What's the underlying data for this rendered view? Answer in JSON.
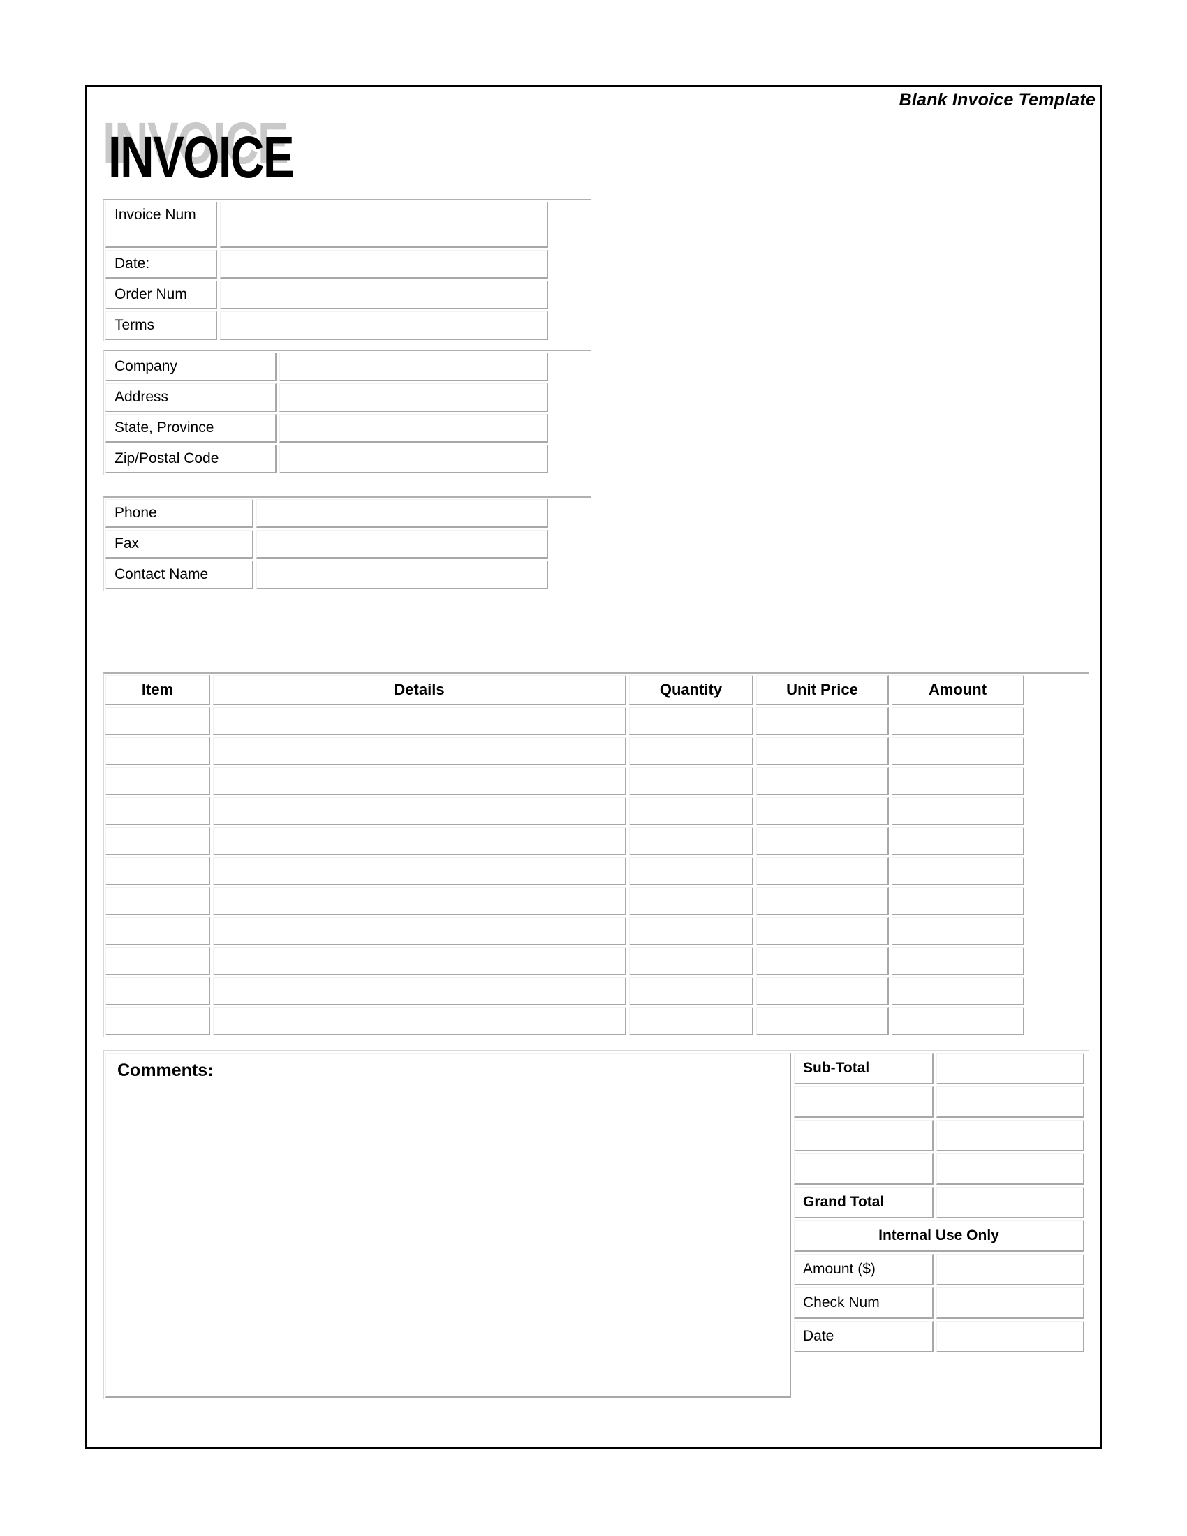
{
  "document": {
    "header_title": "Blank Invoice Template",
    "logo_text": "INVOICE"
  },
  "invoice_info": {
    "rows": [
      {
        "label": "Invoice Num",
        "value": ""
      },
      {
        "label": "Date:",
        "value": ""
      },
      {
        "label": "Order Num",
        "value": ""
      },
      {
        "label": "Terms",
        "value": ""
      }
    ]
  },
  "bill_to": {
    "rows": [
      {
        "label": "Company",
        "value": ""
      },
      {
        "label": "Address",
        "value": ""
      },
      {
        "label": "State, Province",
        "value": ""
      },
      {
        "label": "Zip/Postal Code",
        "value": ""
      }
    ]
  },
  "contact": {
    "rows": [
      {
        "label": "Phone",
        "value": ""
      },
      {
        "label": "Fax",
        "value": ""
      },
      {
        "label": "Contact Name",
        "value": ""
      }
    ]
  },
  "line_items": {
    "columns": [
      "Item",
      "Details",
      "Quantity",
      "Unit Price",
      "Amount"
    ],
    "rows": [
      {
        "item": "",
        "details": "",
        "quantity": "",
        "unit_price": "",
        "amount": ""
      },
      {
        "item": "",
        "details": "",
        "quantity": "",
        "unit_price": "",
        "amount": ""
      },
      {
        "item": "",
        "details": "",
        "quantity": "",
        "unit_price": "",
        "amount": ""
      },
      {
        "item": "",
        "details": "",
        "quantity": "",
        "unit_price": "",
        "amount": ""
      },
      {
        "item": "",
        "details": "",
        "quantity": "",
        "unit_price": "",
        "amount": ""
      },
      {
        "item": "",
        "details": "",
        "quantity": "",
        "unit_price": "",
        "amount": ""
      },
      {
        "item": "",
        "details": "",
        "quantity": "",
        "unit_price": "",
        "amount": ""
      },
      {
        "item": "",
        "details": "",
        "quantity": "",
        "unit_price": "",
        "amount": ""
      },
      {
        "item": "",
        "details": "",
        "quantity": "",
        "unit_price": "",
        "amount": ""
      },
      {
        "item": "",
        "details": "",
        "quantity": "",
        "unit_price": "",
        "amount": ""
      },
      {
        "item": "",
        "details": "",
        "quantity": "",
        "unit_price": "",
        "amount": ""
      }
    ]
  },
  "comments": {
    "label": "Comments:",
    "value": ""
  },
  "totals": {
    "rows": [
      {
        "label": "Sub-Total",
        "value": "",
        "bold": true
      },
      {
        "label": "",
        "value": "",
        "bold": false
      },
      {
        "label": "",
        "value": "",
        "bold": false
      },
      {
        "label": "",
        "value": "",
        "bold": false
      },
      {
        "label": "Grand Total",
        "value": "",
        "bold": true
      }
    ]
  },
  "internal_use": {
    "heading": "Internal Use Only",
    "rows": [
      {
        "label": "Amount ($)",
        "value": ""
      },
      {
        "label": "Check Num",
        "value": ""
      },
      {
        "label": "Date",
        "value": ""
      }
    ]
  },
  "colors": {
    "page_border": "#000000",
    "cell_border": "#a8a8a8",
    "logo_shadow": "#c9c9c9",
    "text": "#000000"
  }
}
